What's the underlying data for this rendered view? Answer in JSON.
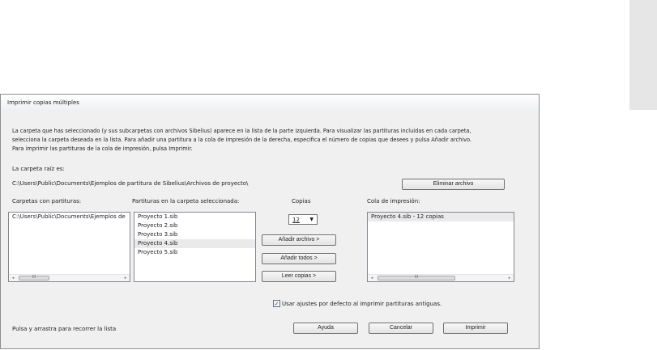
{
  "dialog": {
    "title": "Imprimir copias múltiples",
    "description": "La carpeta que has seleccionado (y sus subcarpetas con archivos Sibelius) aparece en la lista de la parte izquierda.  Para visualizar las partituras incluidas en cada carpeta,\nselecciona la carpeta deseada en la lista.  Para añadir una partitura a la cola de impresión de la derecha, especifica el número de copias que desees y pulsa Añadir archivo.\nPara imprimir las partituras de la cola de impresión, pulsa Imprimir.",
    "root_label": "La carpeta raíz es:",
    "root_path": "C:\\Users\\Public\\Documents\\Ejemplos de partitura de Sibelius\\Archivos de proyecto\\",
    "remove_file_label": "Eliminar archivo",
    "folders": {
      "label": "Carpetas con partituras:",
      "items": [
        "C:\\Users\\Public\\Documents\\Ejemplos de"
      ]
    },
    "scores": {
      "label": "Partituras en la carpeta seleccionada:",
      "items": [
        "Proyecto 1.sib",
        "Proyecto 2.sib",
        "Proyecto 3.sib",
        "Proyecto 4.sib",
        "Proyecto 5.sib"
      ],
      "selected_index": 3
    },
    "copies": {
      "label": "Copias",
      "value": "12",
      "dropdown_icon": "chevron-down-icon"
    },
    "add_file_label": "Añadir archivo >",
    "add_all_label": "Añadir todos >",
    "read_copies_label": "Leer copias >",
    "queue": {
      "label": "Cola de impresión:",
      "items": [
        "Proyecto 4.sib - 12 copias"
      ]
    },
    "scroll_thumb_glyph": "III",
    "scroll_left_glyph": "◂",
    "scroll_right_glyph": "▸",
    "use_defaults": {
      "checked": true,
      "check_glyph": "✓",
      "label": "Usar ajustes por defecto al imprimir partituras antiguas."
    },
    "hint": "Pulsa y arrastra para recorrer la lista",
    "help_label": "Ayuda",
    "cancel_label": "Cancelar",
    "print_label": "Imprimir"
  }
}
